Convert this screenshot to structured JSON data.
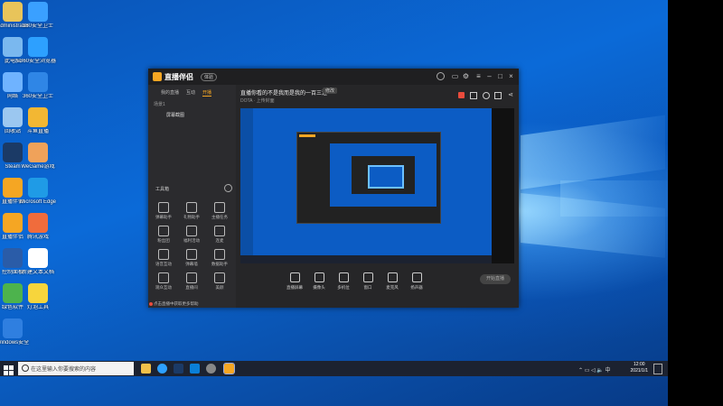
{
  "colors": {
    "accent": "#f5a623",
    "desktop": "#0b6ad8",
    "taskbar": "#1c2230",
    "window": "#262628"
  },
  "desktop": {
    "icons": [
      {
        "label": "Administrator",
        "color": "#e8c45a",
        "icon": "user-folder-icon"
      },
      {
        "label": "360安全卫士",
        "color": "#3aa0ff",
        "icon": "shield-icon"
      },
      {
        "label": "此电脑",
        "color": "#7ab8ef",
        "icon": "computer-icon"
      },
      {
        "label": "360安全浏览器",
        "color": "#2da0ff",
        "icon": "browser-icon"
      },
      {
        "label": "网络",
        "color": "#6fb3ff",
        "icon": "network-icon"
      },
      {
        "label": "360安全卫士",
        "color": "#2f86e6",
        "icon": "shield-icon"
      },
      {
        "label": "回收站",
        "color": "#9bc7f0",
        "icon": "recycle-bin-icon"
      },
      {
        "label": "斗鱼直播",
        "color": "#f2b733",
        "icon": "app-icon"
      },
      {
        "label": "Steam",
        "color": "#1b3a66",
        "icon": "steam-icon"
      },
      {
        "label": "WeGame游戏",
        "color": "#f0a25a",
        "icon": "game-icon"
      },
      {
        "label": "直播伴侣",
        "color": "#f5a623",
        "icon": "app-icon"
      },
      {
        "label": "Microsoft Edge",
        "color": "#1f9be6",
        "icon": "edge-icon"
      },
      {
        "label": "直播伴侣",
        "color": "#f5a623",
        "icon": "app-icon"
      },
      {
        "label": "腾讯游戏",
        "color": "#f06c3c",
        "icon": "app-icon"
      },
      {
        "label": "控制面板",
        "color": "#2a5ca8",
        "icon": "power-icon"
      },
      {
        "label": "新建文本文档",
        "color": "#ffffff",
        "icon": "document-icon"
      },
      {
        "label": "绿色软件",
        "color": "#4db34d",
        "icon": "tree-icon"
      },
      {
        "label": "灯泡工具",
        "color": "#f7d53c",
        "icon": "bulb-icon"
      },
      {
        "label": "Windows安全",
        "color": "#2f7fe0",
        "icon": "security-icon"
      }
    ]
  },
  "taskbar": {
    "search_placeholder": "在这里输入你要搜索的内容",
    "time": "12:00",
    "date": "2021/1/1"
  },
  "app": {
    "name": "直播伴侣",
    "badge": "体验",
    "tabs": [
      "我的直播",
      "互动",
      "开播"
    ],
    "scene_label": "场景1",
    "source_label": "屏幕截图",
    "tools_title": "工具箱",
    "tools": [
      "弹幕助手",
      "礼物助手",
      "主播任务",
      "粉丝团",
      "福利活动",
      "连麦",
      "语音互动",
      "弹幕墙",
      "数据助手",
      "观众互动",
      "直播间",
      "美颜"
    ],
    "stream_title": "直播你看的不是我而是我的一百三连",
    "stream_tag": "修改",
    "stream_meta": "DOTA · 上传封面",
    "bottom": [
      "直播屏幕",
      "摄像头",
      "多机位",
      "窗口",
      "麦克风",
      "扬声器"
    ],
    "live_button": "开始直播",
    "hint": "点击直播中获取更多帮助"
  }
}
